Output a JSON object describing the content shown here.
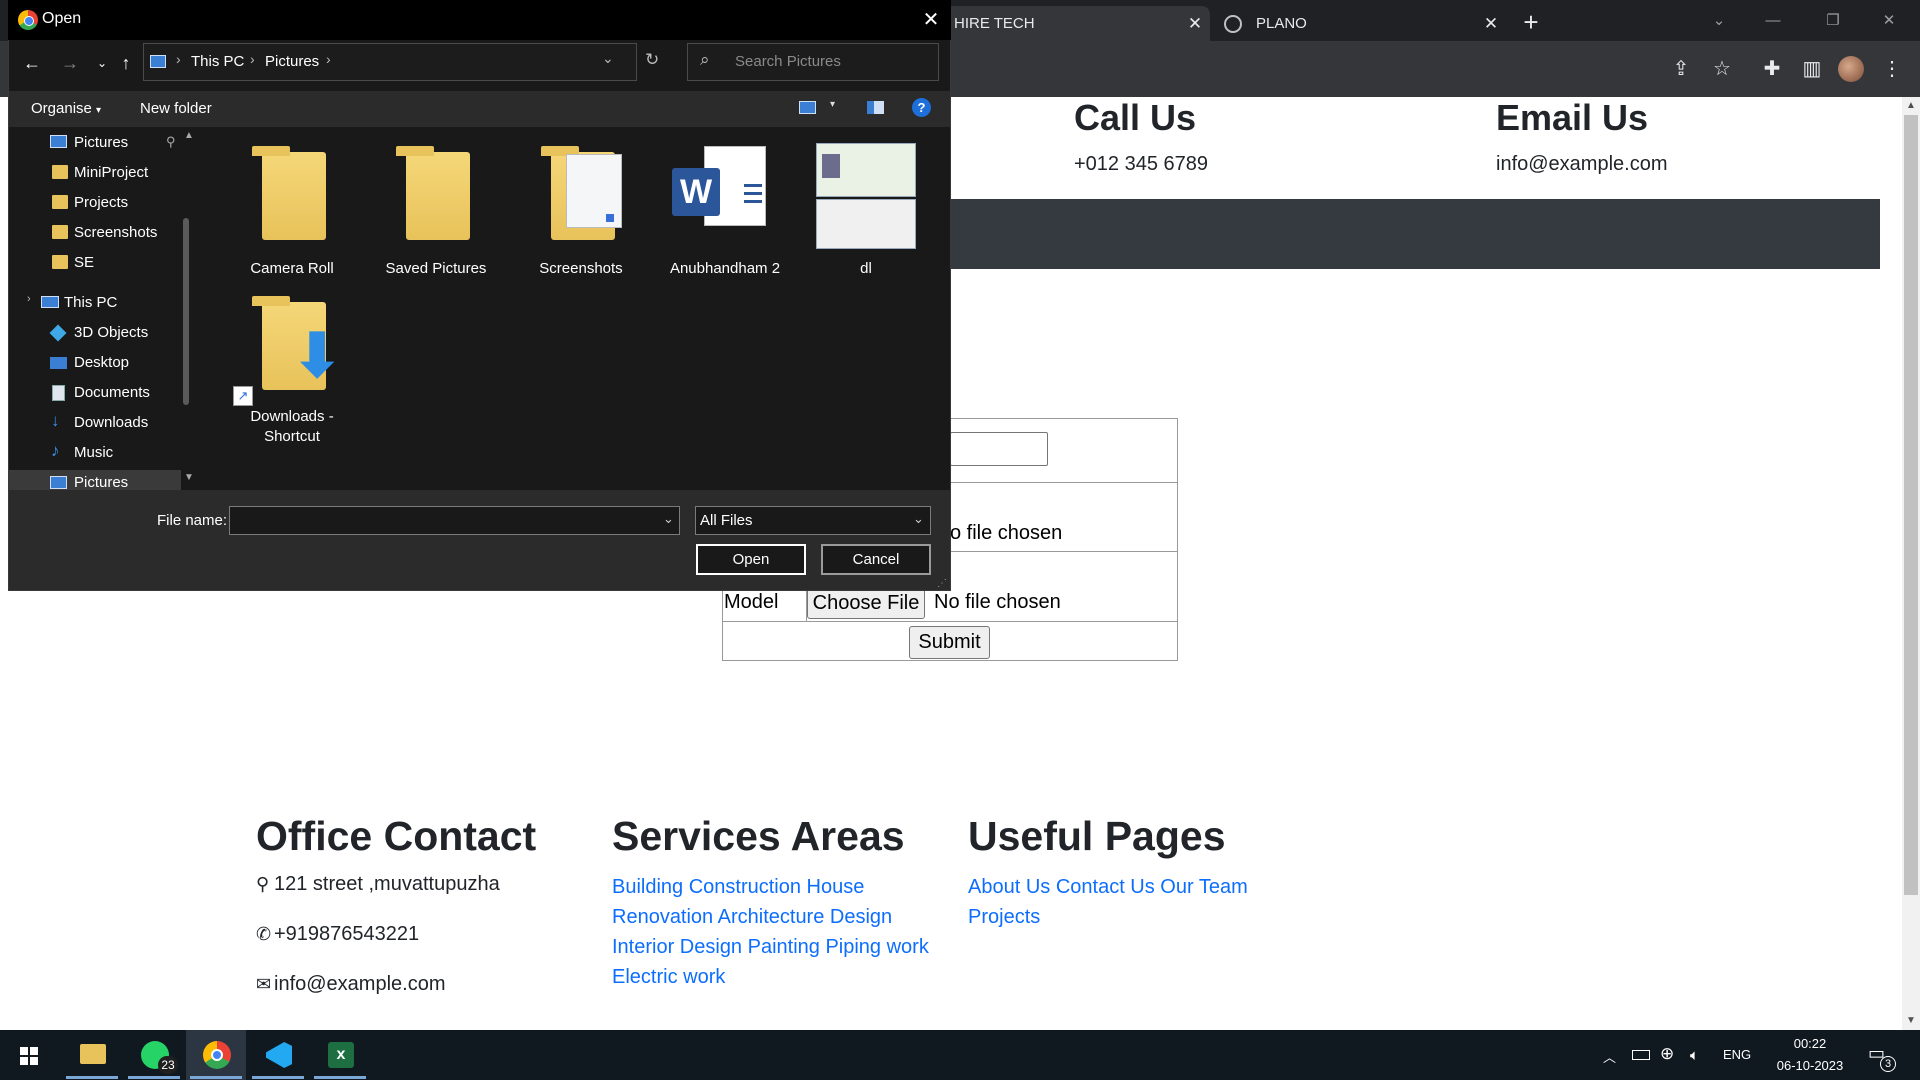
{
  "browser": {
    "tabs": [
      {
        "label": "HIRE TECH"
      },
      {
        "label": "PLANO"
      }
    ],
    "new_tab_icon": "plus-icon"
  },
  "page": {
    "call_heading": "Call Us",
    "call_value": "+012 345 6789",
    "email_heading": "Email Us",
    "email_value": "info@example.com",
    "form": {
      "no_file_1": "o file chosen",
      "model_label": "Model",
      "choose_file": "Choose File",
      "no_file_2": "No file chosen",
      "submit": "Submit"
    },
    "footer": {
      "office_heading": "Office Contact",
      "address": "121 street ,muvattupuzha",
      "phone": "+919876543221",
      "email": "info@example.com",
      "services_heading": "Services Areas",
      "services_lines": [
        "Building Construction House",
        "Renovation Architecture Design",
        "Interior Design Painting Piping work",
        "Electric work"
      ],
      "useful_heading": "Useful Pages",
      "useful_lines": [
        "About Us Contact Us Our Team",
        "Projects"
      ]
    }
  },
  "dialog": {
    "title": "Open",
    "breadcrumb": [
      "This PC",
      "Pictures"
    ],
    "search_placeholder": "Search Pictures",
    "organise": "Organise",
    "new_folder": "New folder",
    "help": "?",
    "nav_items": [
      "Pictures",
      "MiniProject",
      "Projects",
      "Screenshots",
      "SE",
      "This PC",
      "3D Objects",
      "Desktop",
      "Documents",
      "Downloads",
      "Music",
      "Pictures"
    ],
    "files": [
      {
        "name": "Camera Roll"
      },
      {
        "name": "Saved Pictures"
      },
      {
        "name": "Screenshots"
      },
      {
        "name": "Anubhandham 2"
      },
      {
        "name": "dl"
      },
      {
        "name_line1": "Downloads -",
        "name_line2": "Shortcut"
      }
    ],
    "file_name_label": "File name:",
    "file_type": "All Files",
    "open_button": "Open",
    "cancel_button": "Cancel"
  },
  "taskbar": {
    "whatsapp_badge": "23",
    "lang": "ENG",
    "time": "00:22",
    "date": "06-10-2023",
    "notif_count": "3"
  },
  "colors": {
    "accent_blue": "#0d6efd",
    "dialog_bg": "#191919",
    "folder_yellow": "#e8c25a"
  }
}
